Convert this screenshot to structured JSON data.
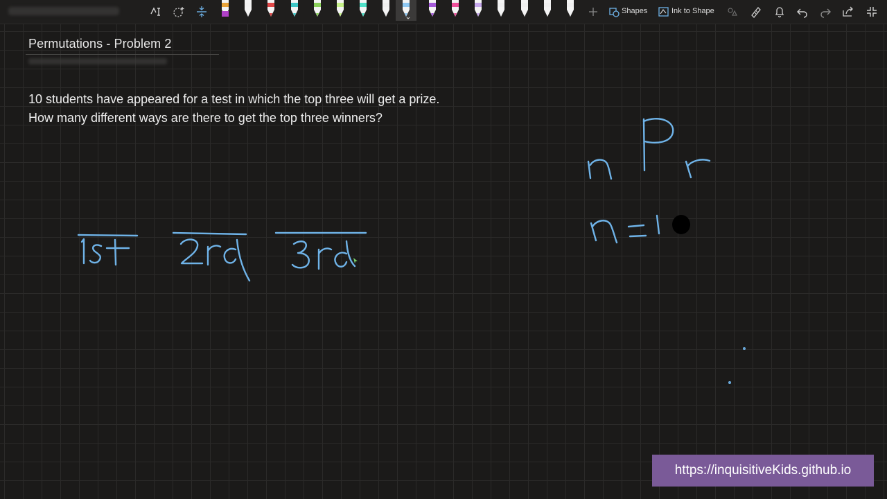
{
  "toolbar": {
    "shapes_label": "Shapes",
    "ink_to_shape_label": "Ink to Shape",
    "pens": [
      {
        "name": "pen-orange-purple",
        "color": "#e8a33a"
      },
      {
        "name": "pen-white",
        "color": "#f2f2f2"
      },
      {
        "name": "pen-red",
        "color": "#e04848"
      },
      {
        "name": "pen-teal",
        "color": "#3ec6c6"
      },
      {
        "name": "pen-green",
        "color": "#8ad05a"
      },
      {
        "name": "pen-lime-highlighter",
        "color": "#c7f28a"
      },
      {
        "name": "pen-aqua",
        "color": "#4fe0c8"
      },
      {
        "name": "pen-white-highlighter",
        "color": "#f0f0f0"
      },
      {
        "name": "pen-lightblue-selected",
        "color": "#8fc8f2"
      },
      {
        "name": "pen-purple",
        "color": "#a45ad8"
      },
      {
        "name": "pen-pink",
        "color": "#ee4f9a"
      },
      {
        "name": "pen-lavender-highlighter",
        "color": "#c6a8ec"
      },
      {
        "name": "pen-white-2",
        "color": "#f0f0f0"
      },
      {
        "name": "pen-white-3",
        "color": "#f0f0f0"
      },
      {
        "name": "pen-white-4",
        "color": "#f0f0f0"
      },
      {
        "name": "pen-white-5",
        "color": "#f0f0f0"
      }
    ]
  },
  "page": {
    "title": "Permutations - Problem 2",
    "problem_text": "10 students have appeared for a test in which the top three will get a prize. How many different ways are there to get the top three winners?"
  },
  "ink": {
    "color": "#6fb3e8",
    "slots": [
      "1st",
      "2nd",
      "3rd"
    ],
    "formula": "nPr",
    "n_value": "n = 10"
  },
  "watermark": {
    "text": "https://inquisitiveKids.github.io",
    "background": "#7a5a98"
  }
}
